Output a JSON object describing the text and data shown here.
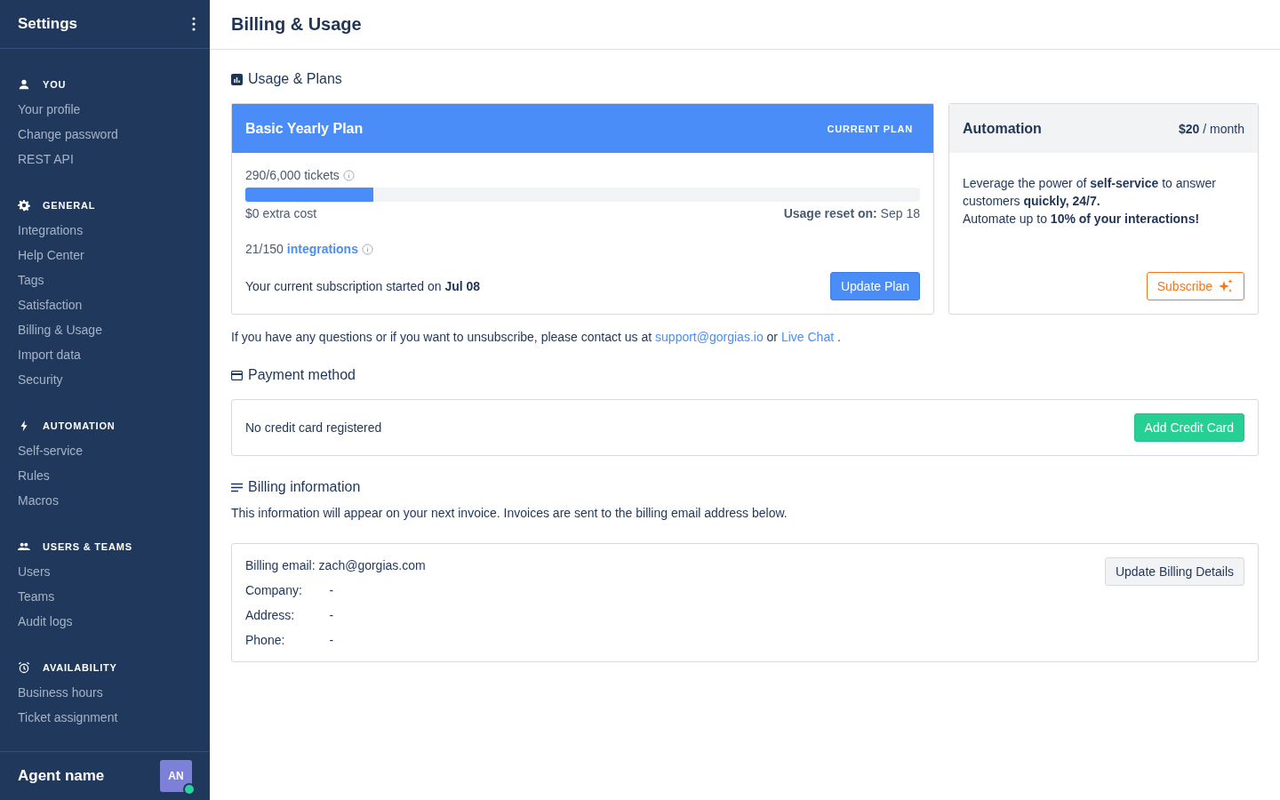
{
  "sidebar": {
    "title": "Settings",
    "sections": [
      {
        "kind": "user",
        "heading": "YOU",
        "items": [
          "Your profile",
          "Change password",
          "REST API"
        ]
      },
      {
        "kind": "gear",
        "heading": "GENERAL",
        "items": [
          "Integrations",
          "Help Center",
          "Tags",
          "Satisfaction",
          "Billing & Usage",
          "Import data",
          "Security"
        ]
      },
      {
        "kind": "bolt",
        "heading": "AUTOMATION",
        "items": [
          "Self-service",
          "Rules",
          "Macros"
        ]
      },
      {
        "kind": "users",
        "heading": "USERS & TEAMS",
        "items": [
          "Users",
          "Teams",
          "Audit logs"
        ]
      },
      {
        "kind": "clock",
        "heading": "AVAILABILITY",
        "items": [
          "Business hours",
          "Ticket assignment"
        ]
      }
    ],
    "agent": {
      "name": "Agent name",
      "initials": "AN"
    }
  },
  "page_title": "Billing & Usage",
  "usage_section": {
    "title": "Usage & Plans",
    "plan": {
      "name": "Basic Yearly Plan",
      "badge": "CURRENT PLAN",
      "tickets": "290/6,000 tickets",
      "level": 0.19,
      "extra_cost": "$0 extra cost",
      "reset": "**Usage reset on:** Sep 18",
      "integrations_count": "21/150",
      "integrations_link": "integrations",
      "subscription": "Your current subscription started on **Jul 08**",
      "button": "Update Plan"
    },
    "automation": {
      "name": "Automation",
      "price": "$20",
      "period": "/ month",
      "description": "Leverage the power of **self-service** to answer customers **quickly, 24/7.**",
      "description_2": "Automate up to **10% of your interactions!**",
      "button": "Subscribe"
    }
  },
  "contact": {
    "text": "If you have any questions or if you want to unsubscribe, please contact us at",
    "email": "support@gorgias.io",
    "or": "or",
    "chat": "Live Chat",
    "end": "."
  },
  "payment": {
    "title": "Payment method",
    "status": "No credit card registered",
    "button": "Add Credit Card"
  },
  "billing": {
    "title": "Billing information",
    "note": "This information will appear on your next invoice. Invoices are sent to the billing email address below.",
    "fields": [
      {
        "label": "Billing email:",
        "value": "zach@gorgias.com"
      },
      {
        "label": "Company:",
        "value": "-"
      },
      {
        "label": "Address:",
        "value": "-"
      },
      {
        "label": "Phone:",
        "value": "-"
      }
    ],
    "button": "Update Billing Details"
  }
}
